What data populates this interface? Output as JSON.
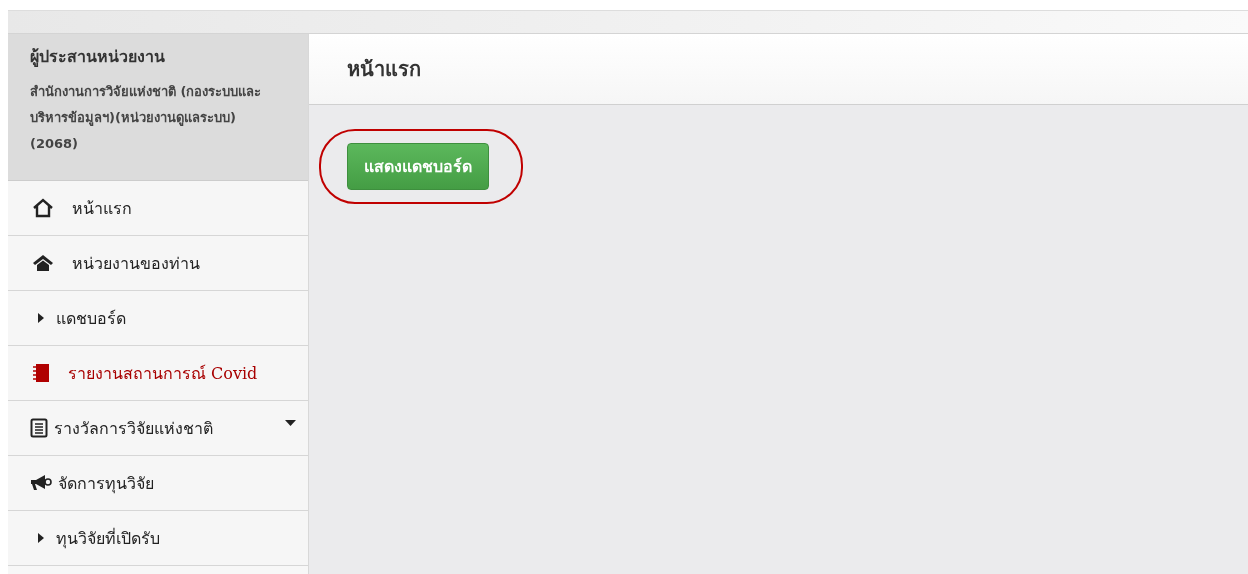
{
  "sidebar": {
    "role": "ผู้ประสานหน่วยงาน",
    "organization": "สำนักงานการวิจัยแห่งชาติ (กองระบบและบริหารข้อมูลฯ)(หน่วยงานดูแลระบบ)(2068)",
    "items": [
      {
        "label": "หน้าแรก",
        "kind": "home",
        "highlighted": false,
        "expandable": false
      },
      {
        "label": "หน่วยงานของท่าน",
        "kind": "house",
        "highlighted": false,
        "expandable": false
      },
      {
        "label": "แดชบอร์ด",
        "kind": "sub",
        "highlighted": false,
        "expandable": false
      },
      {
        "label": "รายงานสถานการณ์ Covid",
        "kind": "report",
        "highlighted": true,
        "expandable": false
      },
      {
        "label": "รางวัลการวิจัยแห่งชาติ",
        "kind": "document",
        "highlighted": false,
        "expandable": true
      },
      {
        "label": "จัดการทุนวิจัย",
        "kind": "megaphone",
        "highlighted": false,
        "expandable": false
      },
      {
        "label": "ทุนวิจัยที่เปิดรับ",
        "kind": "sub",
        "highlighted": false,
        "expandable": false
      }
    ]
  },
  "main": {
    "title": "หน้าแรก",
    "button": "แสดงแดชบอร์ด"
  }
}
